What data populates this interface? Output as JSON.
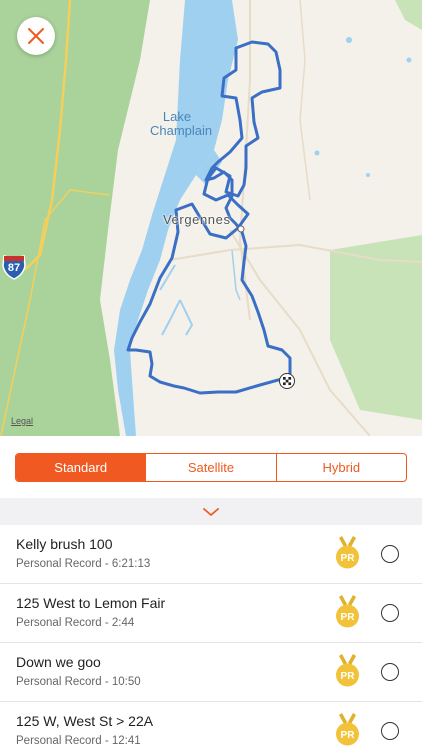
{
  "map": {
    "lake_label_line1": "Lake",
    "lake_label_line2": "Champlain",
    "town_label": "Vergennes",
    "legal_label": "Legal",
    "highway_shield": "87",
    "close_icon": "close-x-icon",
    "finish_icon": "checkered-flag-icon",
    "route_color": "#3b6fc6",
    "water_color": "#9fd0f0",
    "forest_color": "#a9d39a"
  },
  "map_type": {
    "options": [
      "Standard",
      "Satellite",
      "Hybrid"
    ],
    "selected": "Standard",
    "accent_color": "#f05a22"
  },
  "collapse_icon": "chevron-down-icon",
  "segments": [
    {
      "name": "Kelly brush 100",
      "record_label": "Personal Record",
      "record_time": "6:21:13",
      "subtitle": "Personal Record - 6:21:13",
      "badge": "PR"
    },
    {
      "name": "125 West to Lemon Fair",
      "record_label": "Personal Record",
      "record_time": "2:44",
      "subtitle": "Personal Record - 2:44",
      "badge": "PR"
    },
    {
      "name": "Down we goo",
      "record_label": "Personal Record",
      "record_time": "10:50",
      "subtitle": "Personal Record - 10:50",
      "badge": "PR"
    },
    {
      "name": "125 W, West St > 22A",
      "record_label": "Personal Record",
      "record_time": "12:41",
      "subtitle": "Personal Record - 12:41",
      "badge": "PR"
    }
  ]
}
